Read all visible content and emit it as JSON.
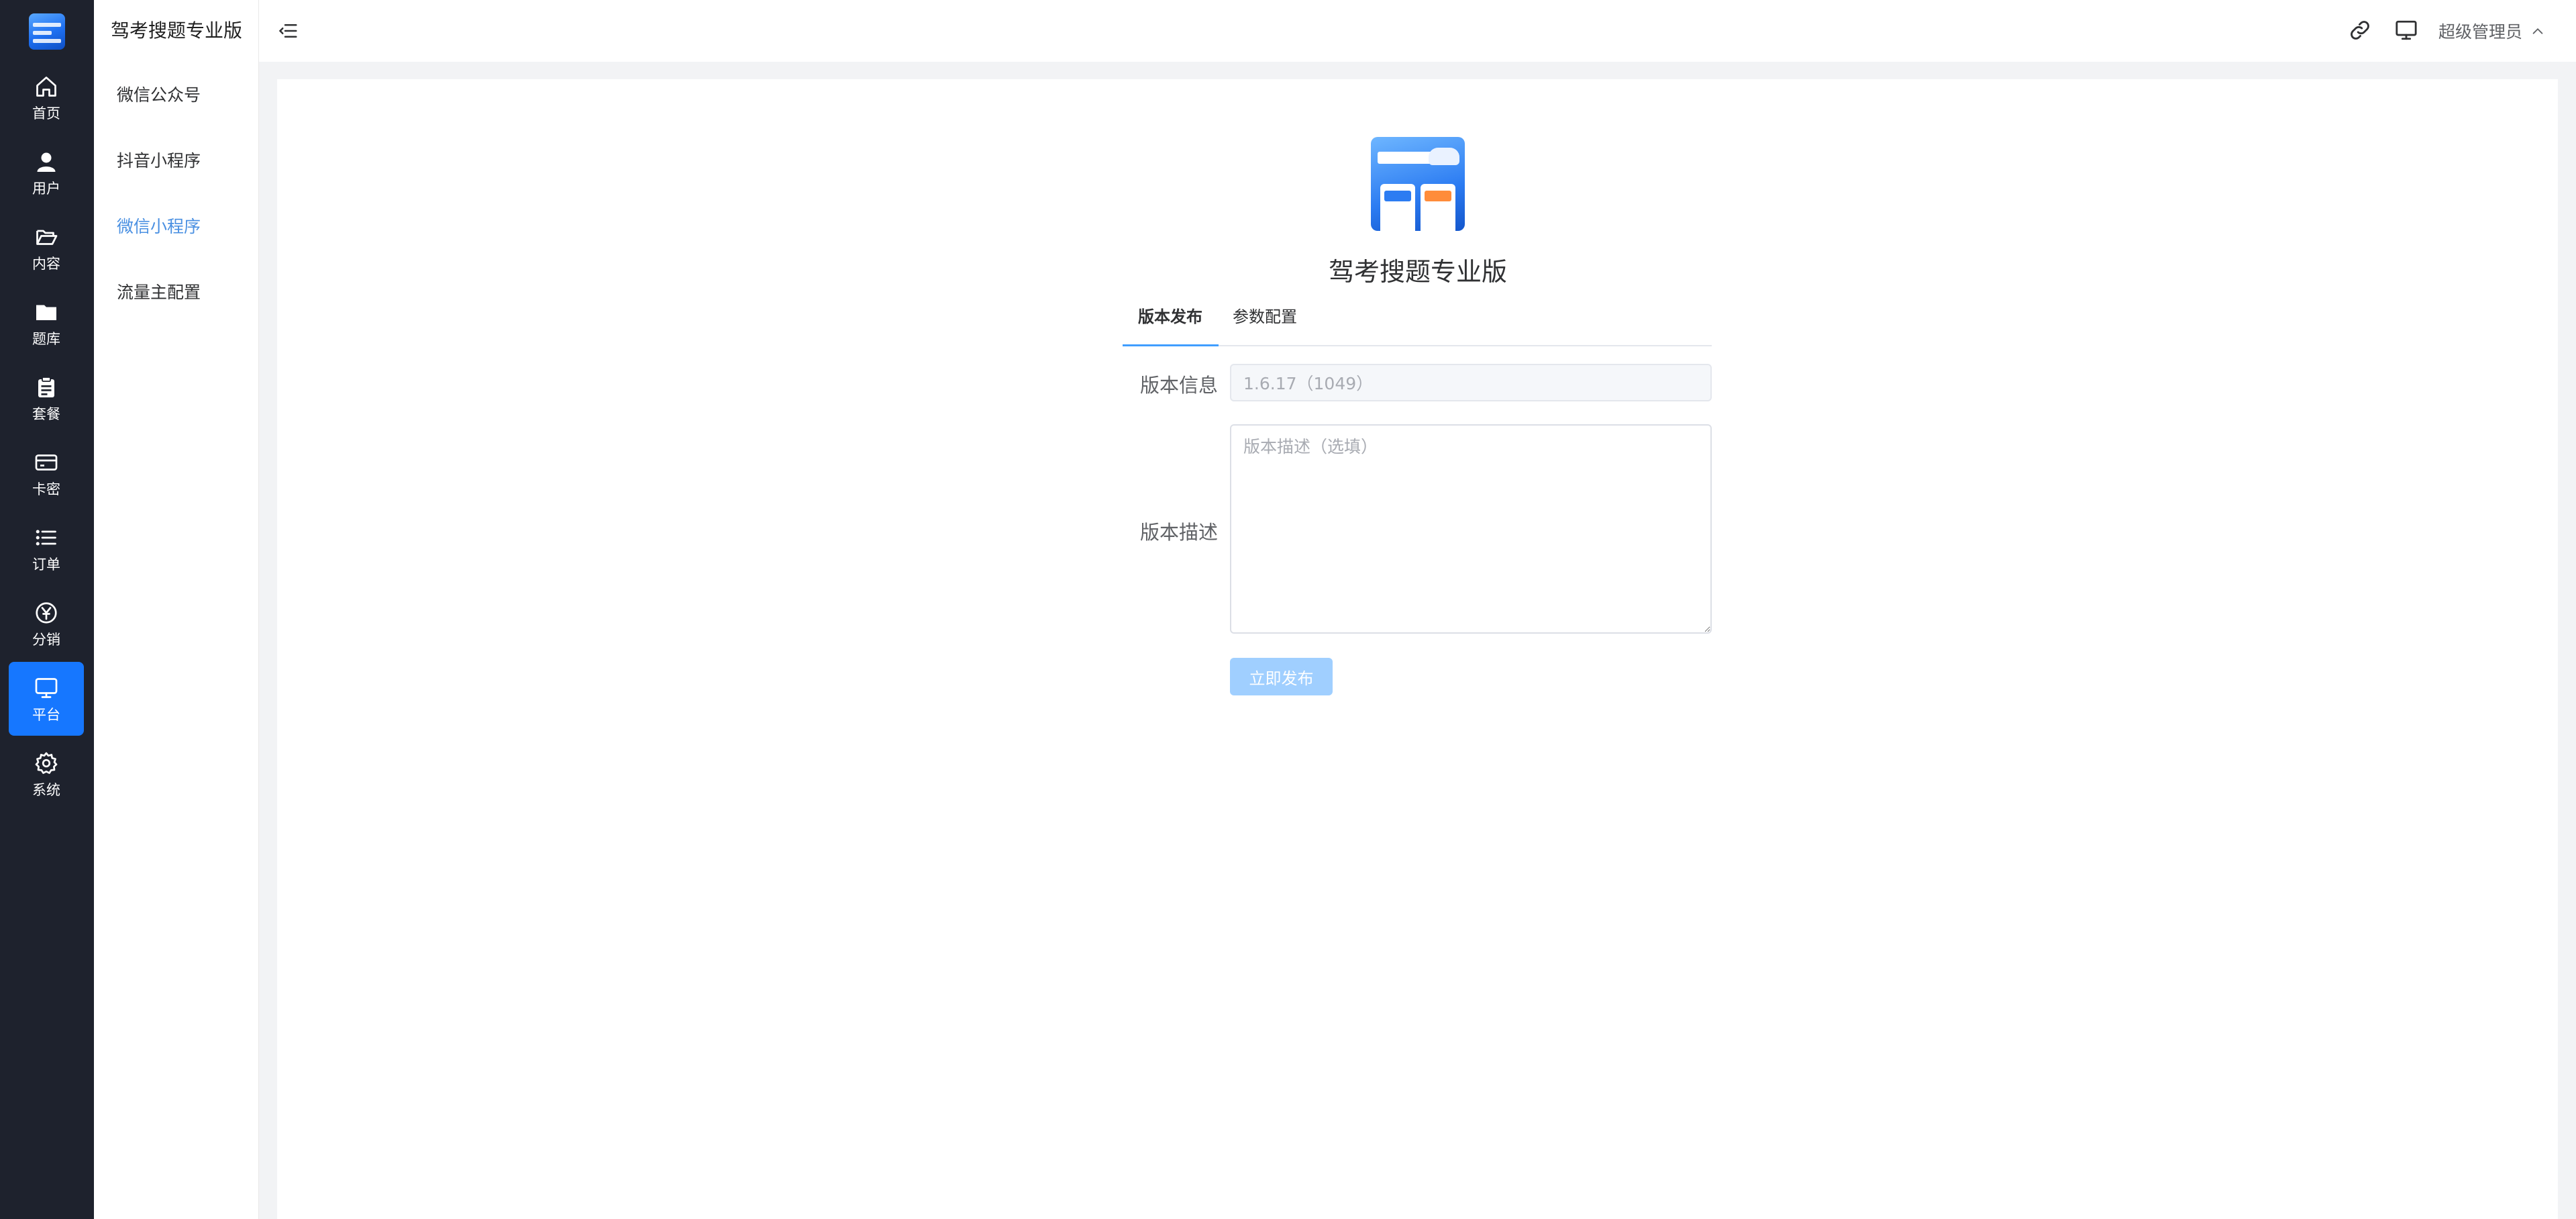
{
  "rail": {
    "items": [
      {
        "label": "首页",
        "icon": "home-icon"
      },
      {
        "label": "用户",
        "icon": "user-icon"
      },
      {
        "label": "内容",
        "icon": "folder-open-icon"
      },
      {
        "label": "题库",
        "icon": "folder-icon"
      },
      {
        "label": "套餐",
        "icon": "clipboard-icon"
      },
      {
        "label": "卡密",
        "icon": "credit-card-icon"
      },
      {
        "label": "订单",
        "icon": "list-icon"
      },
      {
        "label": "分销",
        "icon": "yen-circle-icon"
      },
      {
        "label": "平台",
        "icon": "monitor-icon",
        "active": true
      },
      {
        "label": "系统",
        "icon": "gear-icon"
      }
    ]
  },
  "submenu": {
    "title": "驾考搜题专业版",
    "items": [
      {
        "label": "微信公众号"
      },
      {
        "label": "抖音小程序"
      },
      {
        "label": "微信小程序",
        "active": true
      },
      {
        "label": "流量主配置"
      }
    ]
  },
  "header": {
    "user_name": "超级管理员"
  },
  "main": {
    "app_name": "驾考搜题专业版",
    "tabs": [
      {
        "label": "版本发布",
        "active": true
      },
      {
        "label": "参数配置"
      }
    ],
    "form": {
      "version_info_label": "版本信息",
      "version_info_value": "1.6.17（1049）",
      "version_desc_label": "版本描述",
      "version_desc_placeholder": "版本描述（选填）",
      "submit_label": "立即发布"
    }
  },
  "colors": {
    "rail_bg": "#1e222d",
    "accent": "#1677ff",
    "submenu_active": "#4a90e2",
    "button_disabled": "#a0cfff"
  }
}
